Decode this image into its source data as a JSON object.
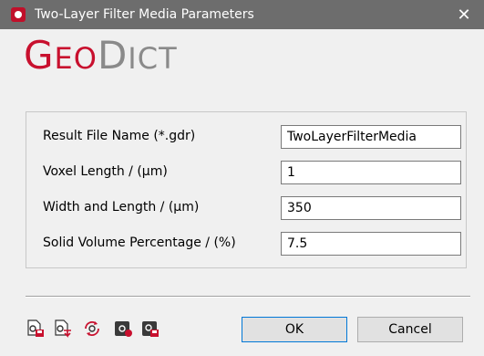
{
  "window": {
    "title": "Two-Layer Filter Media Parameters",
    "close_glyph": "✕",
    "icon": "geodict-app-icon"
  },
  "logo": {
    "big1": "G",
    "small1": "EO",
    "big2": "D",
    "small2": "ICT",
    "colors": {
      "primary": "#c8102e",
      "secondary": "#8a8a8a"
    }
  },
  "form": {
    "fields": [
      {
        "label": "Result File Name (*.gdr)",
        "value": "TwoLayerFilterMedia"
      },
      {
        "label": "Voxel Length / (µm)",
        "value": "1"
      },
      {
        "label": "Width and Length / (µm)",
        "value": "350"
      },
      {
        "label": "Solid Volume Percentage / (%)",
        "value": "7.5"
      }
    ]
  },
  "toolbar": {
    "icons": [
      "save-settings-icon",
      "load-settings-icon",
      "reset-settings-icon",
      "record-macro-icon",
      "save-macro-icon"
    ]
  },
  "buttons": {
    "ok": "OK",
    "cancel": "Cancel"
  }
}
